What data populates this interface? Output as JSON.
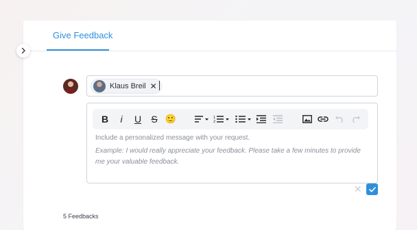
{
  "tabs": {
    "active_label": "Give Feedback"
  },
  "recipients": [
    {
      "name": "Klaus Breil"
    }
  ],
  "editor": {
    "placeholder": "Include a personalized message with your request.",
    "example": "Example: I would really appreciate your feedback. Please take a few minutes to provide me your valuable feedback."
  },
  "toolbar": {
    "bold": "B",
    "italic": "i",
    "underline": "U",
    "strike": "S",
    "emoji": "🙂"
  },
  "footer": {
    "count_label": "5 Feedbacks"
  },
  "colors": {
    "accent": "#2f8fdd",
    "border": "#cfd3da"
  }
}
